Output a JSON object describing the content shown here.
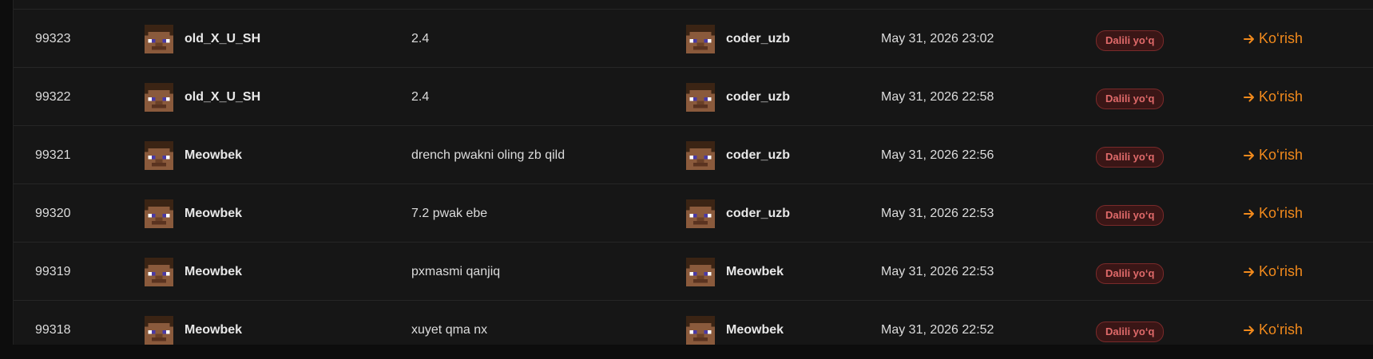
{
  "accent_color": "#f28a1c",
  "status_color": "#e06a6a",
  "rows": [
    {
      "id": "99323",
      "user": "old_X_U_SH",
      "reason": "2.4",
      "admin": "coder_uzb",
      "date": "May 31, 2026 23:02",
      "status": "Dalili yo‘q",
      "action": "Ko‘rish"
    },
    {
      "id": "99322",
      "user": "old_X_U_SH",
      "reason": "2.4",
      "admin": "coder_uzb",
      "date": "May 31, 2026 22:58",
      "status": "Dalili yo‘q",
      "action": "Ko‘rish"
    },
    {
      "id": "99321",
      "user": "Meowbek",
      "reason": "drench pwakni oling zb qild",
      "admin": "coder_uzb",
      "date": "May 31, 2026 22:56",
      "status": "Dalili yo‘q",
      "action": "Ko‘rish"
    },
    {
      "id": "99320",
      "user": "Meowbek",
      "reason": "7.2 pwak ebe",
      "admin": "coder_uzb",
      "date": "May 31, 2026 22:53",
      "status": "Dalili yo‘q",
      "action": "Ko‘rish"
    },
    {
      "id": "99319",
      "user": "Meowbek",
      "reason": "pxmasmi qanjiq",
      "admin": "Meowbek",
      "date": "May 31, 2026 22:53",
      "status": "Dalili yo‘q",
      "action": "Ko‘rish"
    },
    {
      "id": "99318",
      "user": "Meowbek",
      "reason": "xuyet qma nx",
      "admin": "Meowbek",
      "date": "May 31, 2026 22:52",
      "status": "Dalili yo‘q",
      "action": "Ko‘rish"
    }
  ]
}
